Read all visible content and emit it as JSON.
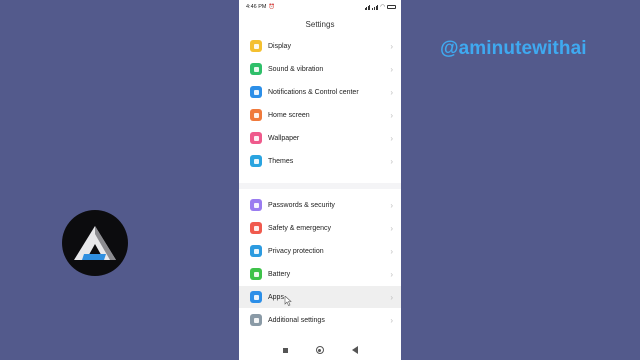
{
  "overlay": {
    "handle": "@aminutewithai",
    "logo_icon": "triangle-a-logo"
  },
  "status_bar": {
    "time": "4:46 PM",
    "notification_icon": "clock-icon",
    "battery_icon": "battery-icon",
    "battery_color": "#3ec24a"
  },
  "screen": {
    "title": "Settings"
  },
  "settings": {
    "group1": [
      {
        "label": "Display",
        "icon": "sun-icon",
        "color": "#f4c030"
      },
      {
        "label": "Sound & vibration",
        "icon": "speaker-icon",
        "color": "#2fbf6a"
      },
      {
        "label": "Notifications & Control center",
        "icon": "bell-icon",
        "color": "#2c8fe8"
      },
      {
        "label": "Home screen",
        "icon": "home-icon",
        "color": "#f07a3c"
      },
      {
        "label": "Wallpaper",
        "icon": "flower-icon",
        "color": "#ef5a8c"
      },
      {
        "label": "Themes",
        "icon": "brush-icon",
        "color": "#2aa4e0"
      }
    ],
    "group2": [
      {
        "label": "Passwords & security",
        "icon": "fingerprint-icon",
        "color": "#9a7cf0"
      },
      {
        "label": "Safety & emergency",
        "icon": "shield-icon",
        "color": "#f05a4e"
      },
      {
        "label": "Privacy protection",
        "icon": "lock-icon",
        "color": "#2c9be0"
      },
      {
        "label": "Battery",
        "icon": "battery-icon",
        "color": "#3ec24a"
      },
      {
        "label": "Apps",
        "icon": "gear-icon",
        "color": "#2c8fe8"
      },
      {
        "label": "Additional settings",
        "icon": "more-icon",
        "color": "#8a9aa6"
      }
    ]
  },
  "navigation": {
    "recents_icon": "square-icon",
    "home_icon": "circle-icon",
    "back_icon": "triangle-back-icon"
  }
}
